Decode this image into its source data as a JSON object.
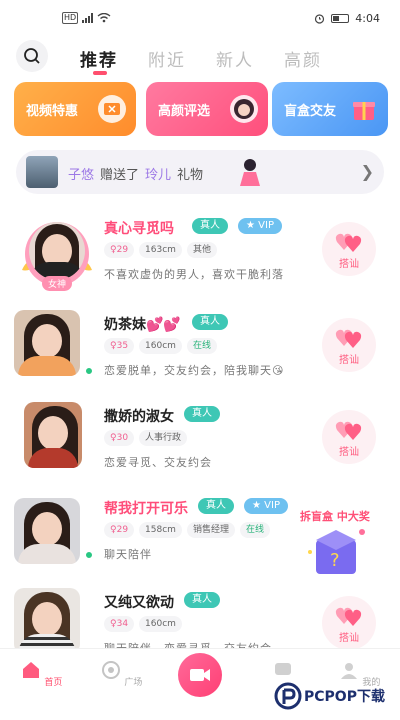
{
  "status_bar": {
    "hd": "HD",
    "time": "4:04"
  },
  "nav": {
    "tabs": [
      "推荐",
      "附近",
      "新人",
      "高颜"
    ],
    "active": 0
  },
  "categories": [
    {
      "label": "视频特惠",
      "color": "#ff9f3a",
      "icon": "ticket-icon"
    },
    {
      "label": "高颜评选",
      "color": "#ff5a85",
      "icon": "beauty-avatar-icon"
    },
    {
      "label": "盲盒交友",
      "color": "#5aa7ff",
      "icon": "giftbox-icon"
    }
  ],
  "gift_bar": {
    "sender": "子悠",
    "action": "赠送了",
    "receiver": "玲儿",
    "suffix": "礼物"
  },
  "users": [
    {
      "name": "真心寻觅吗",
      "verified": "真人",
      "vip": "VIP",
      "age": "29",
      "height": "163cm",
      "job": "其他",
      "online": "",
      "bio": "不喜欢虚伪的男人，喜欢干脆利落",
      "chat": "搭讪",
      "name_color": "pink",
      "badge": "女神"
    },
    {
      "name": "奶茶妹💕💕",
      "verified": "真人",
      "vip": "",
      "age": "35",
      "height": "160cm",
      "job": "",
      "online": "在线",
      "bio": "恋爱脱单，交友约会，陪我聊天😘",
      "chat": "搭讪",
      "name_color": "dark",
      "badge": ""
    },
    {
      "name": "撒娇的淑女",
      "verified": "真人",
      "vip": "",
      "age": "30",
      "height": "",
      "job": "人事行政",
      "online": "",
      "bio": "恋爱寻觅、交友约会",
      "chat": "搭讪",
      "name_color": "dark",
      "badge": ""
    },
    {
      "name": "帮我打开可乐",
      "verified": "真人",
      "vip": "VIP",
      "age": "29",
      "height": "158cm",
      "job": "销售经理",
      "online": "在线",
      "bio": "聊天陪伴",
      "chat": "",
      "name_color": "pink",
      "badge": ""
    },
    {
      "name": "又纯又欲动",
      "verified": "真人",
      "vip": "",
      "age": "34",
      "height": "160cm",
      "job": "",
      "online": "",
      "bio": "聊天陪伴，恋爱寻觅，交友约会",
      "chat": "搭讪",
      "name_color": "dark",
      "badge": ""
    }
  ],
  "blindbox": {
    "title": "拆盲盒 中大奖"
  },
  "bottom_nav": [
    {
      "label": "首页",
      "icon": "home-icon"
    },
    {
      "label": "广场",
      "icon": "square-icon"
    },
    {
      "label": "",
      "icon": "video-call-icon"
    },
    {
      "label": "",
      "icon": "message-icon"
    },
    {
      "label": "我的",
      "icon": "profile-icon"
    }
  ],
  "watermark": {
    "text": "PCPOP下载"
  }
}
